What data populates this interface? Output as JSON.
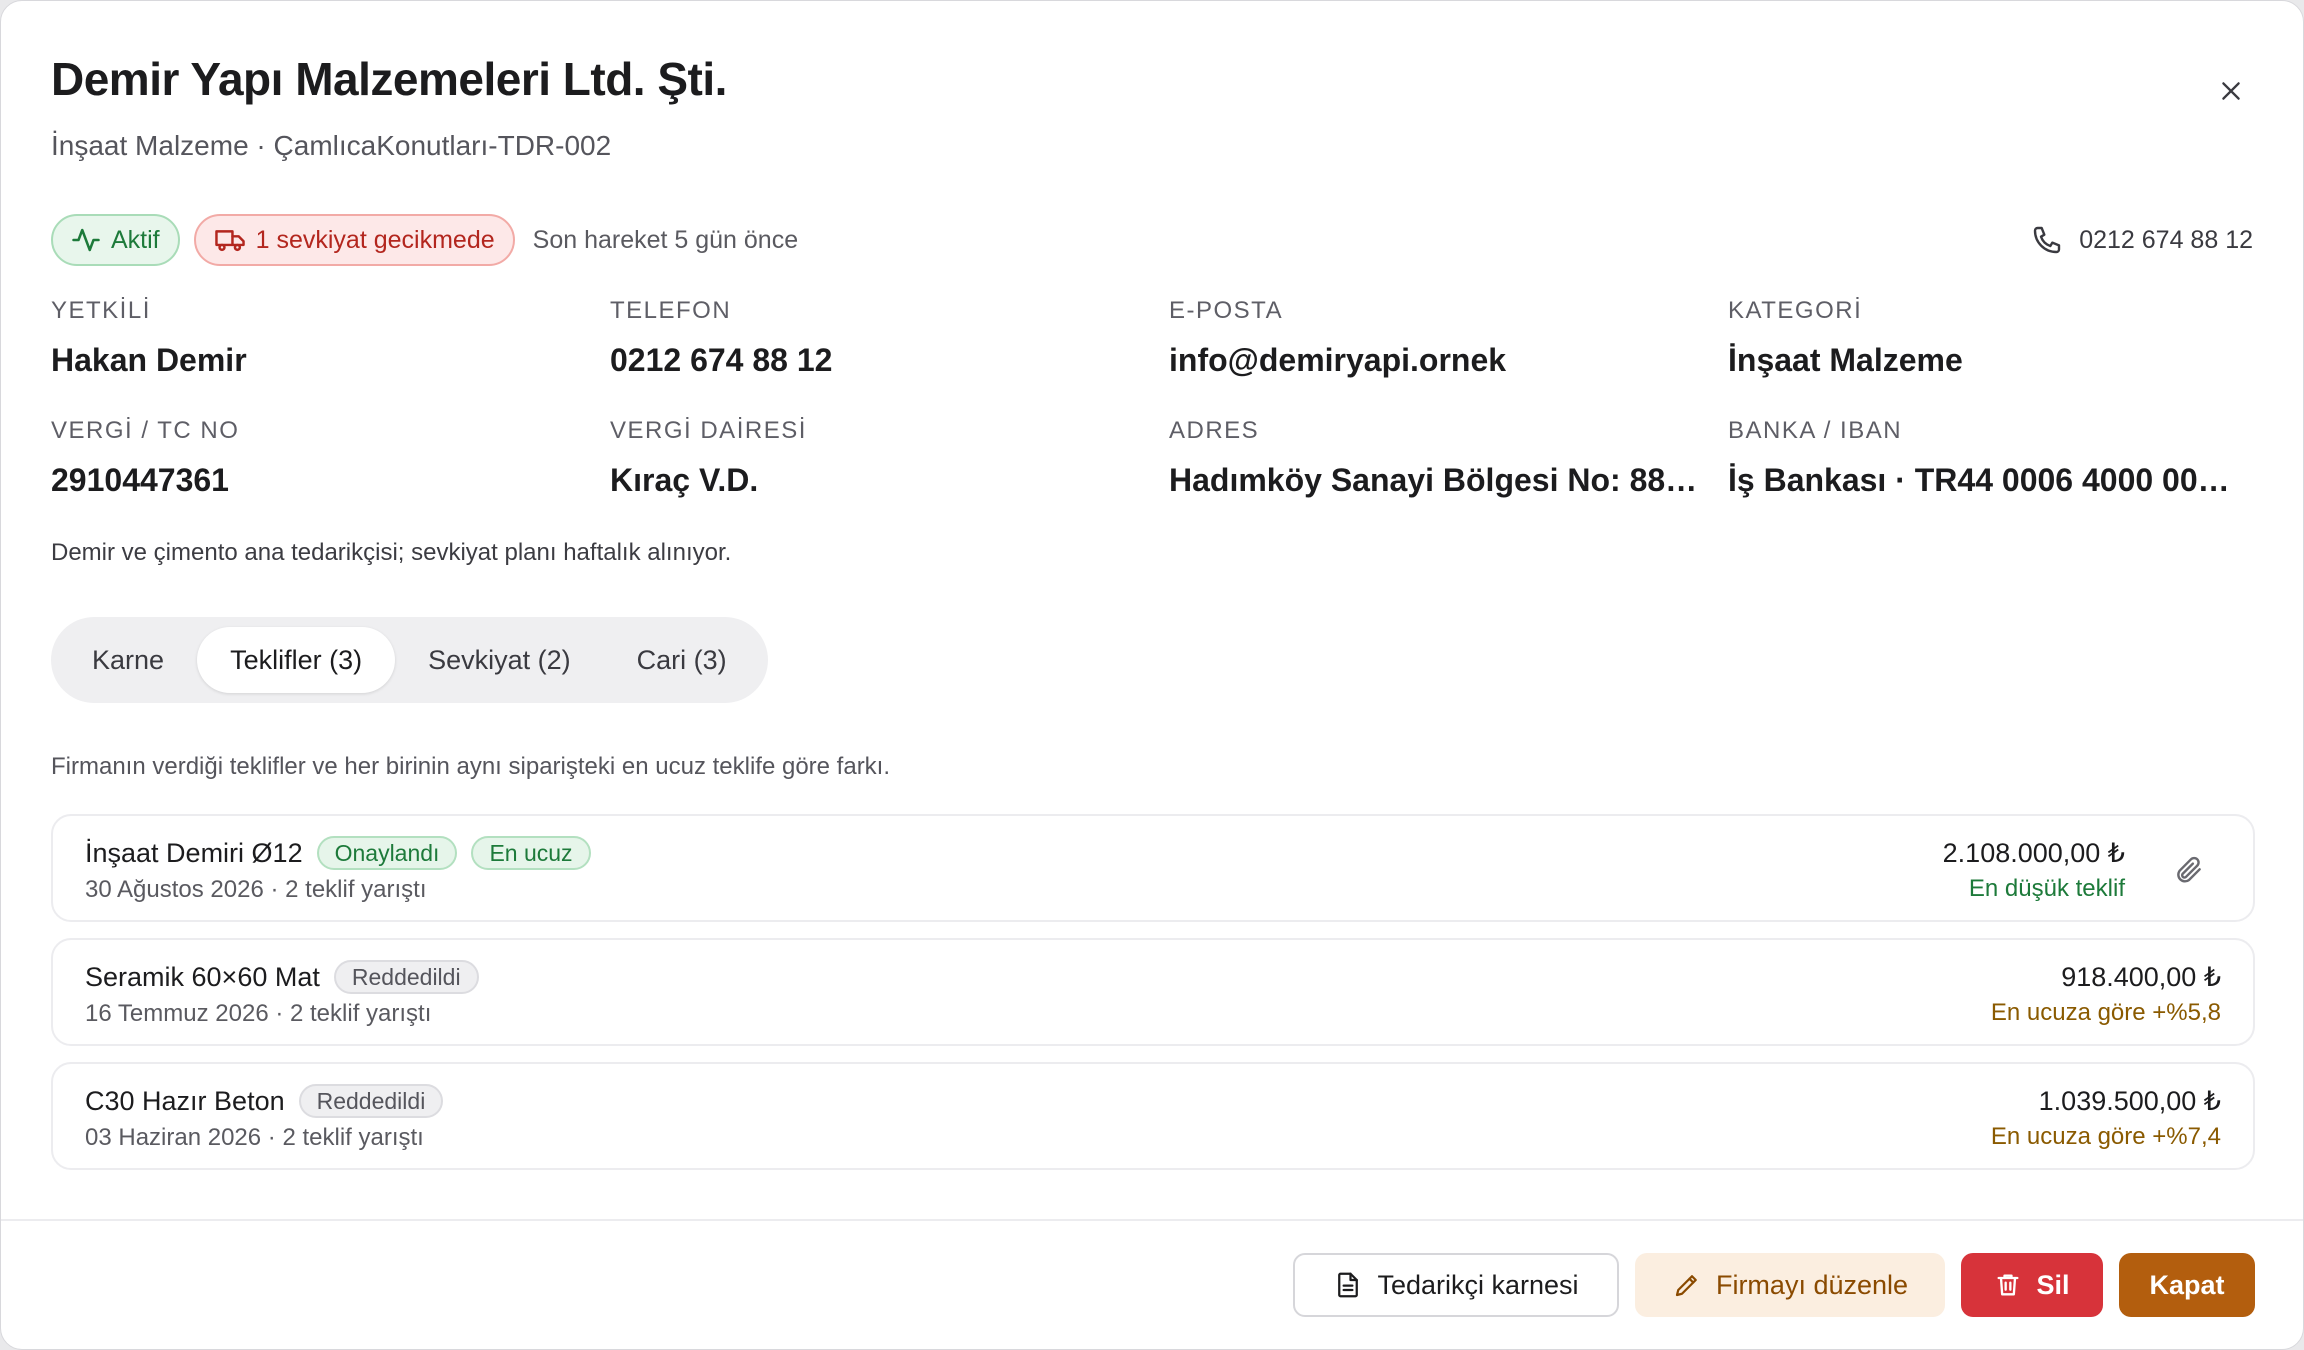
{
  "header": {
    "title": "Demir Yapı Malzemeleri Ltd. Şti.",
    "subtitle": "İnşaat Malzeme · ÇamlıcaKonutları-TDR-002"
  },
  "status": {
    "active_label": "Aktif",
    "delay_label": "1 sevkiyat gecikmede",
    "last_move": "Son hareket 5 gün önce",
    "phone": "0212 674 88 12"
  },
  "info": {
    "contact_label": "YETKİLİ",
    "contact_value": "Hakan Demir",
    "phone_label": "TELEFON",
    "phone_value": "0212 674 88 12",
    "email_label": "E-POSTA",
    "email_value": "info@demiryapi.ornek",
    "category_label": "KATEGORİ",
    "category_value": "İnşaat Malzeme",
    "tax_label": "VERGİ / TC NO",
    "tax_value": "2910447361",
    "office_label": "VERGİ DAİRESİ",
    "office_value": "Kıraç V.D.",
    "address_label": "ADRES",
    "address_value": "Hadımköy Sanayi Bölgesi No: 88…",
    "bank_label": "BANKA / IBAN",
    "bank_value": "İş Bankası · TR44 0006 4000 00…"
  },
  "note": "Demir ve çimento ana tedarikçisi; sevkiyat planı haftalık alınıyor.",
  "tabs": [
    {
      "label": "Karne"
    },
    {
      "label": "Teklifler (3)"
    },
    {
      "label": "Sevkiyat (2)"
    },
    {
      "label": "Cari (3)"
    }
  ],
  "offers_description": "Firmanın verdiği teklifler ve her birinin aynı siparişteki en ucuz teklife göre farkı.",
  "offers": [
    {
      "name": "İnşaat Demiri Ø12",
      "status": "Onaylandı",
      "tag": "En ucuz",
      "meta": "30 Ağustos 2026 · 2 teklif yarıştı",
      "amount": "2.108.000,00 ₺",
      "diff": "En düşük teklif"
    },
    {
      "name": "Seramik 60×60 Mat",
      "status": "Reddedildi",
      "meta": "16 Temmuz 2026 · 2 teklif yarıştı",
      "amount": "918.400,00 ₺",
      "diff": "En ucuza göre +%5,8"
    },
    {
      "name": "C30 Hazır Beton",
      "status": "Reddedildi",
      "meta": "03 Haziran 2026 · 2 teklif yarıştı",
      "amount": "1.039.500,00 ₺",
      "diff": "En ucuza göre +%7,4"
    }
  ],
  "footer": {
    "card_label": "Tedarikçi karnesi",
    "edit_label": "Firmayı düzenle",
    "delete_label": "Sil",
    "close_label": "Kapat"
  },
  "icons": {
    "close": "close-icon",
    "activity": "activity-icon",
    "truck": "truck-icon",
    "phone": "phone-icon",
    "attach": "paperclip-icon",
    "document": "document-icon",
    "pencil": "pencil-icon",
    "trash": "trash-icon"
  },
  "colors": {
    "success": "#1d7a3a",
    "danger": "#d7333a",
    "brand": "#b35e0e",
    "amber_text": "#8a5a00"
  }
}
